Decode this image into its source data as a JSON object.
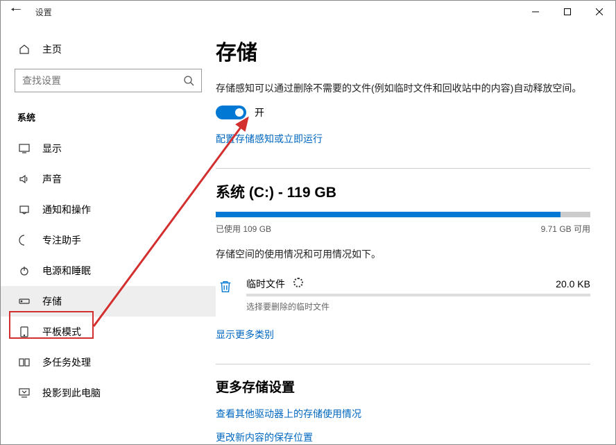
{
  "titlebar": {
    "back_aria": "返回",
    "title": "设置"
  },
  "sidebar": {
    "home": "主页",
    "search_placeholder": "查找设置",
    "section": "系统",
    "items": [
      {
        "label": "显示"
      },
      {
        "label": "声音"
      },
      {
        "label": "通知和操作"
      },
      {
        "label": "专注助手"
      },
      {
        "label": "电源和睡眠"
      },
      {
        "label": "存储",
        "selected": true
      },
      {
        "label": "平板模式"
      },
      {
        "label": "多任务处理"
      },
      {
        "label": "投影到此电脑"
      }
    ]
  },
  "main": {
    "title": "存储",
    "sense_desc": "存储感知可以通过删除不需要的文件(例如临时文件和回收站中的内容)自动释放空间。",
    "toggle_state": "开",
    "configure_link": "配置存储感知或立即运行",
    "drive": {
      "title": "系统 (C:) - 119 GB",
      "used_label": "已使用 109 GB",
      "free_label": "9.71 GB 可用",
      "usage_desc": "存储空间的使用情况和可用情况如下。"
    },
    "category": {
      "name": "临时文件",
      "size": "20.0 KB",
      "sub": "选择要删除的临时文件"
    },
    "show_more": "显示更多类别",
    "more_settings_head": "更多存储设置",
    "link_other_drives": "查看其他驱动器上的存储使用情况",
    "link_save_location": "更改新内容的保存位置"
  }
}
